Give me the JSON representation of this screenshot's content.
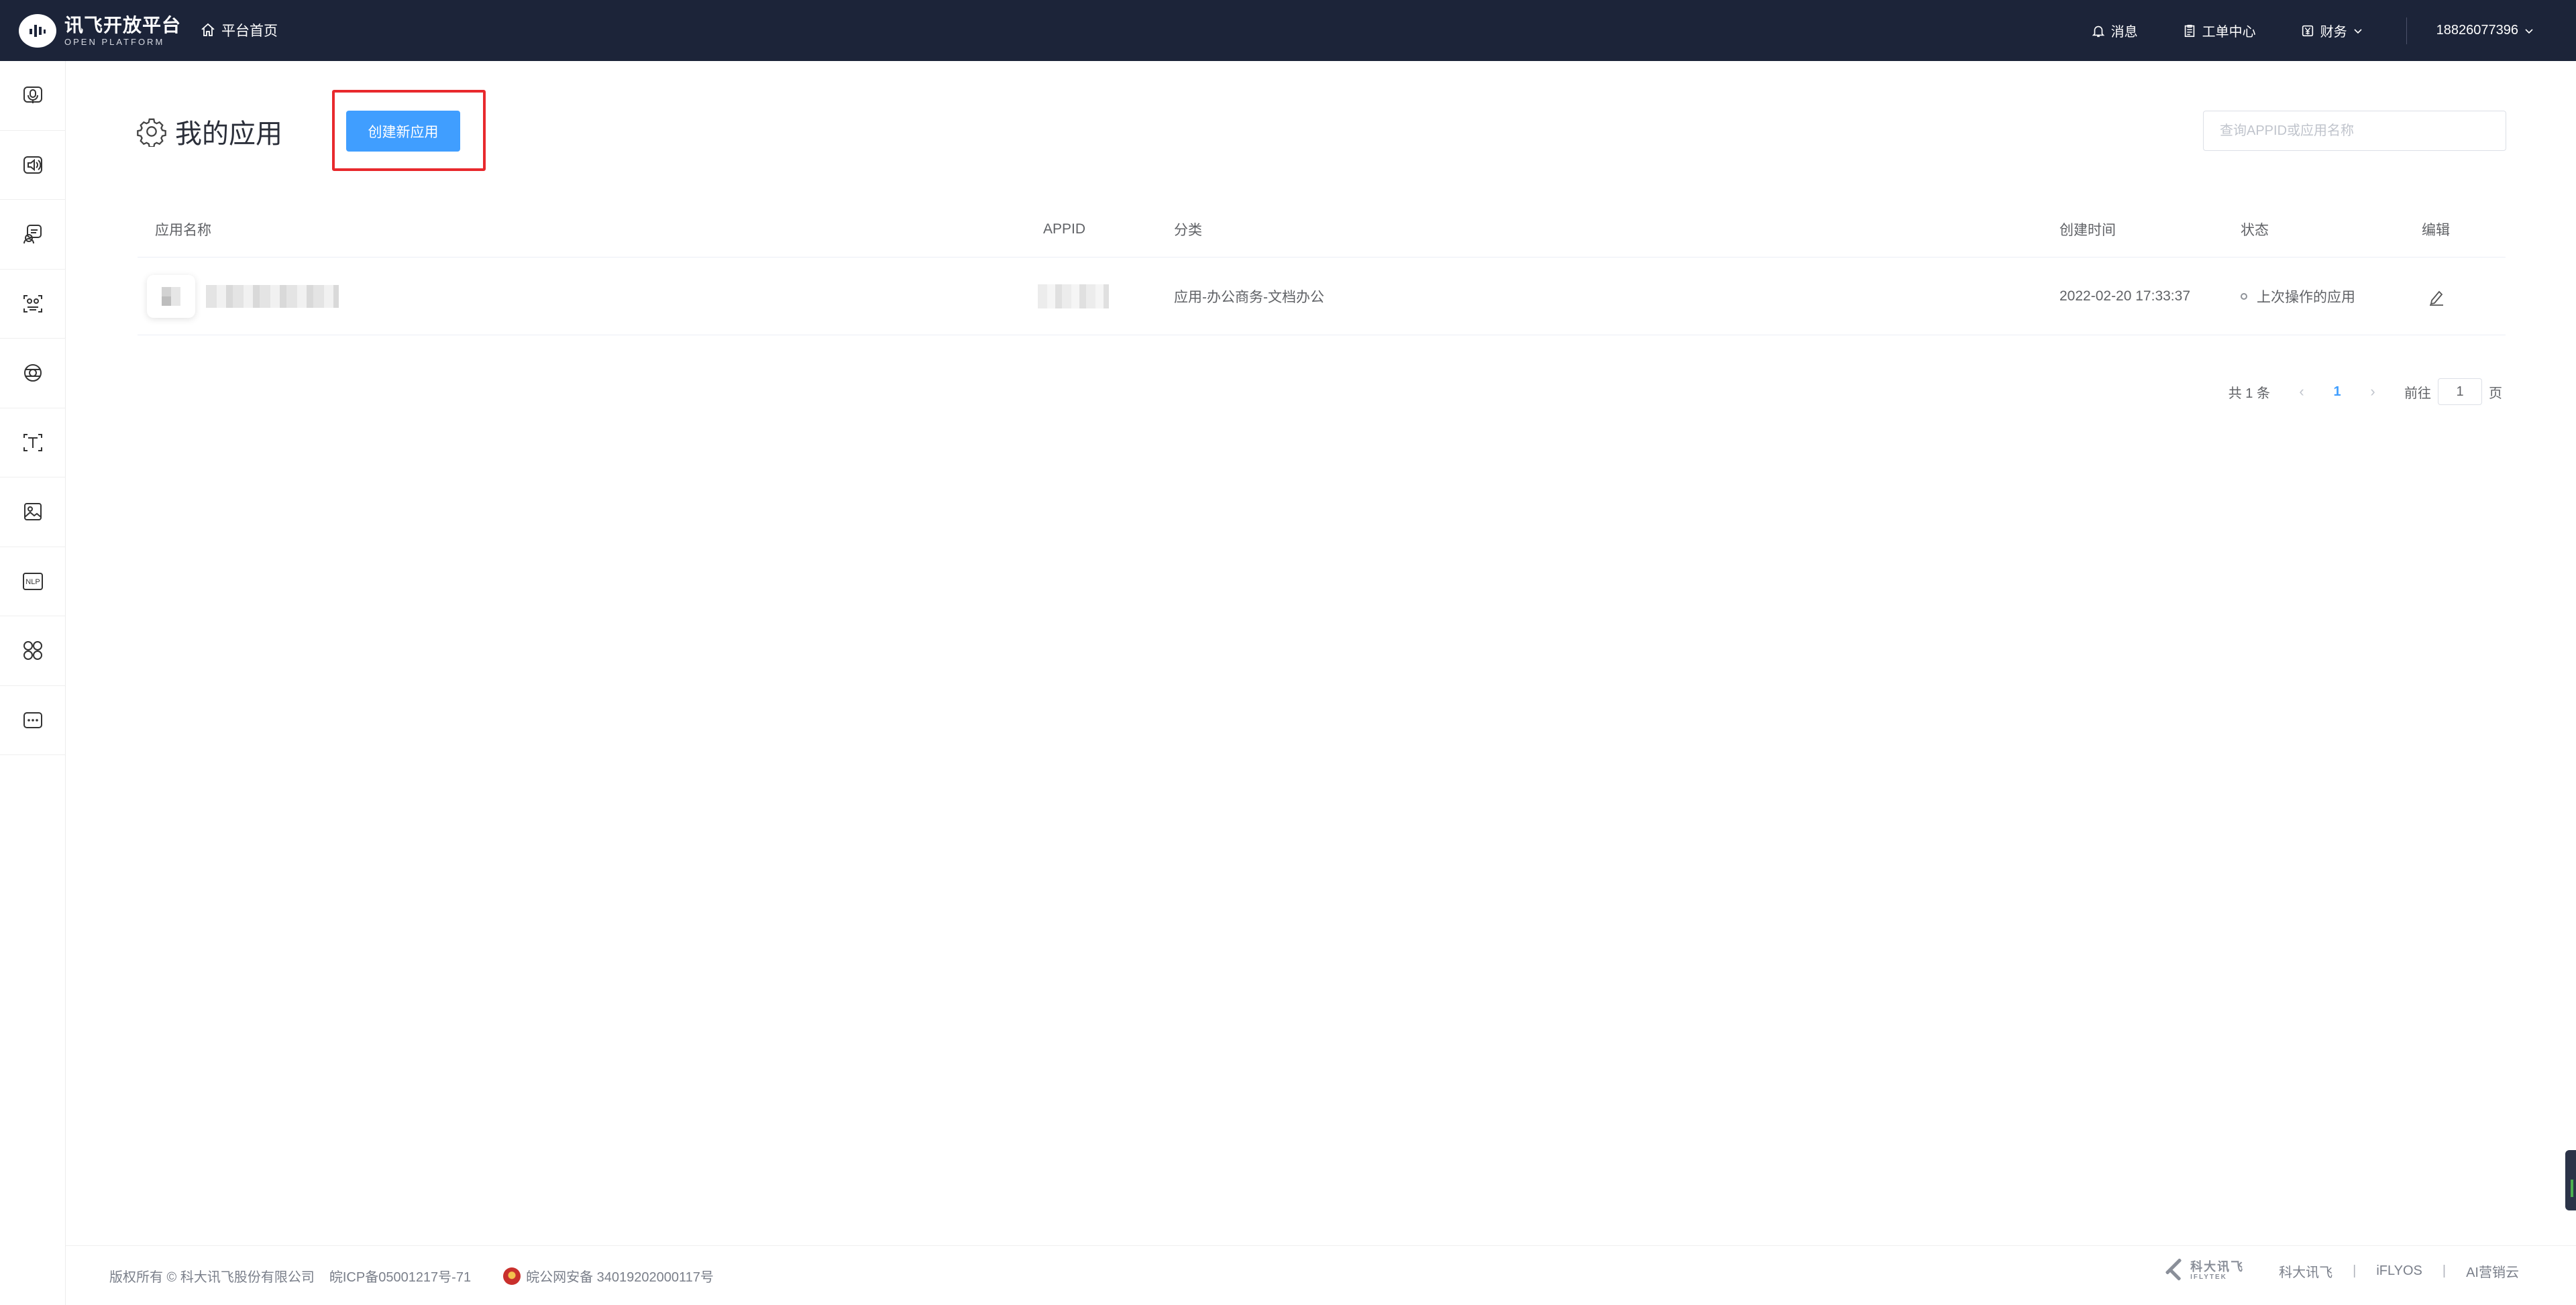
{
  "header": {
    "logo_cn": "讯飞开放平台",
    "logo_en": "OPEN PLATFORM",
    "home_label": "平台首页",
    "nav": {
      "messages": "消息",
      "tickets": "工单中心",
      "finance": "财务",
      "user": "18826077396"
    }
  },
  "sidebar": {
    "items": [
      "voice-dictation-icon",
      "speech-synthesis-icon",
      "voice-interaction-icon",
      "face-recognition-icon",
      "image-understanding-icon",
      "text-recognition-icon",
      "image-icon",
      "nlp-icon",
      "apps-icon",
      "more-icon"
    ],
    "nlp_label": "NLP"
  },
  "main": {
    "title": "我的应用",
    "create_button": "创建新应用",
    "search_placeholder": "查询APPID或应用名称",
    "table": {
      "headers": {
        "name": "应用名称",
        "appid": "APPID",
        "category": "分类",
        "created": "创建时间",
        "status": "状态",
        "edit": "编辑"
      },
      "rows": [
        {
          "category": "应用-办公商务-文档办公",
          "created": "2022-02-20 17:33:37",
          "status": "上次操作的应用"
        }
      ]
    },
    "pagination": {
      "total": "共 1 条",
      "current": "1",
      "goto_prefix": "前往",
      "goto_value": "1",
      "goto_suffix": "页"
    }
  },
  "footer": {
    "copyright": "版权所有 © 科大讯飞股份有限公司",
    "icp": "皖ICP备05001217号-71",
    "police": "皖公网安备 34019202000117号",
    "brand_cn": "科大讯飞",
    "brand_en": "IFLYTEK",
    "links": [
      "科大讯飞",
      "iFLYOS",
      "AI营销云"
    ],
    "separator": "|"
  },
  "colors": {
    "topbar": "#1c2439",
    "primary": "#409eff",
    "highlight": "#e8292d"
  }
}
